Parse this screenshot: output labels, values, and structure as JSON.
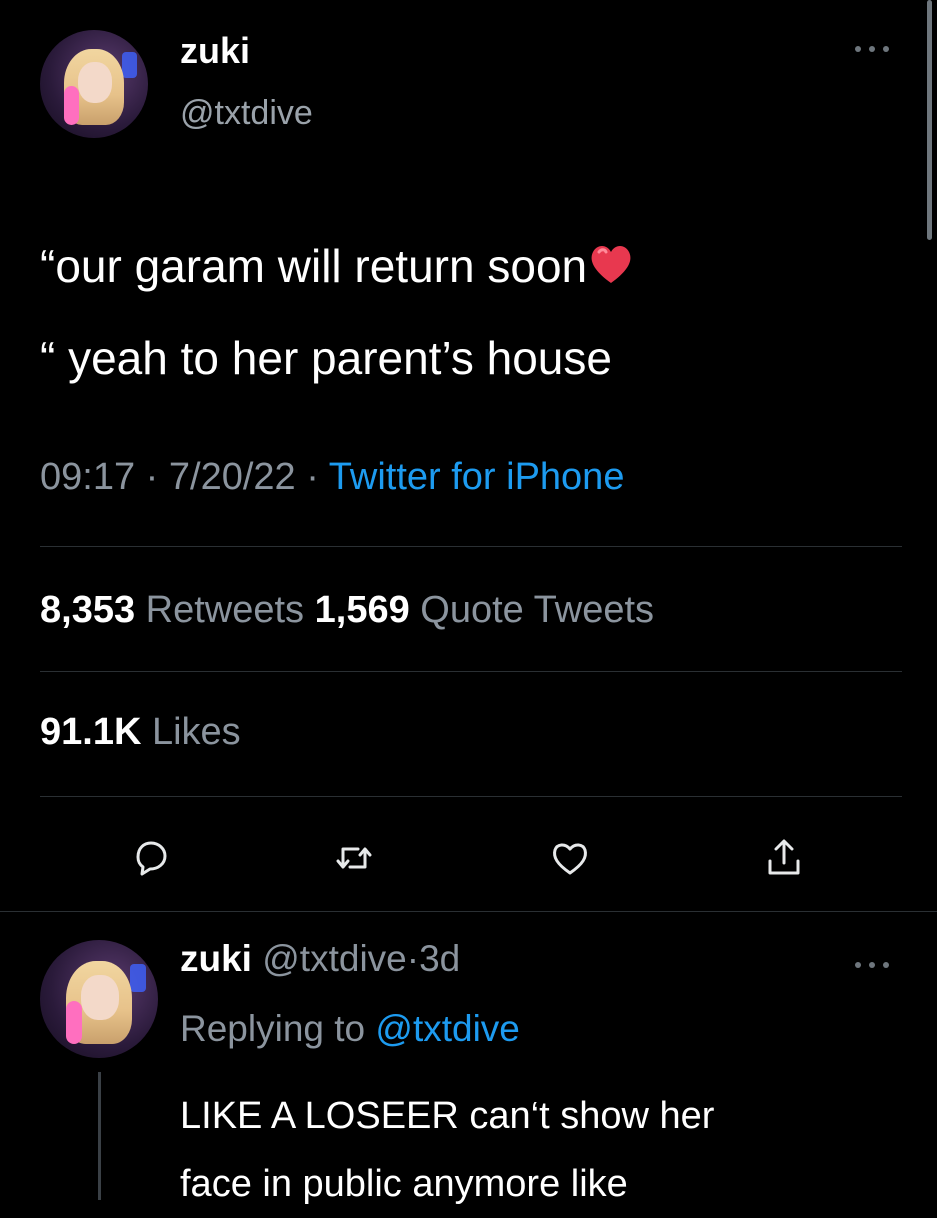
{
  "tweet": {
    "author_name": "zuki",
    "author_handle": "@txtdive",
    "text_line1": "“our garam will return soon",
    "text_line2": "“ yeah to her parent’s house",
    "time": "09:17",
    "date": "7/20/22",
    "sep": "·",
    "source": "Twitter for iPhone",
    "retweets_count": "8,353",
    "retweets_label": "Retweets",
    "quotes_count": "1,569",
    "quotes_label": "Quote Tweets",
    "likes_count": "91.1K",
    "likes_label": "Likes"
  },
  "reply": {
    "author_name": "zuki",
    "author_handle": "@txtdive",
    "sep": "·",
    "age": "3d",
    "replying_label": "Replying to",
    "replying_to": "@txtdive",
    "text_line1": "LIKE A LOSEER can‘t show her",
    "text_line2": "face in public anymore like"
  },
  "icons": {
    "more": "more-horizontal-icon",
    "reply": "reply-icon",
    "retweet": "retweet-icon",
    "like": "heart-icon",
    "share": "share-icon",
    "emoji": "red-heart-emoji-icon"
  },
  "colors": {
    "background": "#000000",
    "text": "#ffffff",
    "secondary": "#8b949e",
    "accent": "#1d9bf0"
  }
}
